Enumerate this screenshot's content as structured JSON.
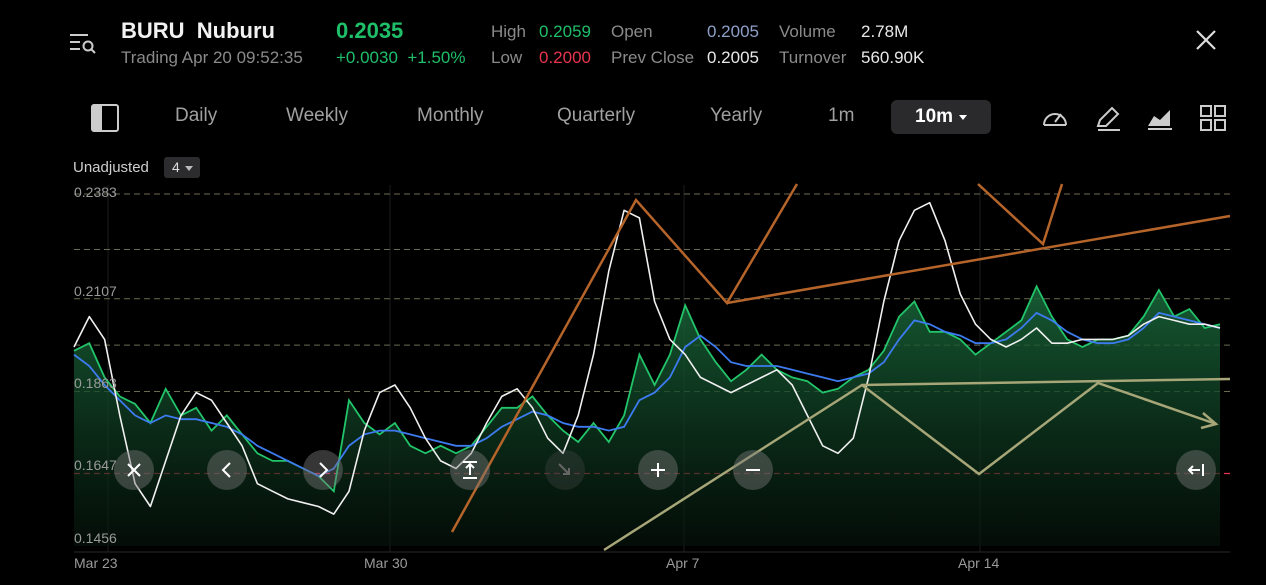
{
  "header": {
    "symbol": "BURU  Nuburu",
    "trading": "Trading Apr 20 09:52:35",
    "price": "0.2035",
    "change": "+0.0030  +1.50%",
    "high_label": "High",
    "high_value": "0.2059",
    "low_label": "Low",
    "low_value": "0.2000",
    "open_label": "Open",
    "open_value": "0.2005",
    "prev_close_label": "Prev Close",
    "prev_close_value": "0.2005",
    "volume_label": "Volume",
    "volume_value": "2.78M",
    "turnover_label": "Turnover",
    "turnover_value": "560.90K"
  },
  "tabs": [
    "Daily",
    "Weekly",
    "Monthly",
    "Quarterly",
    "Yearly",
    "1m"
  ],
  "active_tab": "10m",
  "toolbar_icons": [
    "layout-toggle-icon",
    "speedometer-icon",
    "pen-icon",
    "area-chart-icon",
    "grid-icon"
  ],
  "chart": {
    "adjust_label": "Unadjusted",
    "indicator_count": "4",
    "y_ticks": [
      "0.2383",
      "0.2107",
      "0.1863",
      "0.1647",
      "0.1456"
    ],
    "x_ticks": [
      "Mar 23",
      "Mar 30",
      "Apr 7",
      "Apr 14"
    ]
  },
  "chart_data": {
    "type": "area",
    "x_range": [
      "Mar 23",
      "Apr 20"
    ],
    "ylim": [
      0.1456,
      0.2383
    ],
    "y_ticks": [
      0.2383,
      0.2107,
      0.1863,
      0.1647,
      0.1456
    ],
    "x_ticks": [
      "Mar 23",
      "Mar 30",
      "Apr 7",
      "Apr 14"
    ],
    "reference_line": 0.1647,
    "grid": true,
    "series": [
      {
        "values": [
          0.197,
          0.199,
          0.19,
          0.185,
          0.183,
          0.178,
          0.187,
          0.18,
          0.182,
          0.176,
          0.18,
          0.175,
          0.17,
          0.168,
          0.168,
          0.166,
          0.164,
          0.16,
          0.184,
          0.178,
          0.175,
          0.178,
          0.172,
          0.17,
          0.172,
          0.17,
          0.172,
          0.177,
          0.182,
          0.182,
          0.185,
          0.18,
          0.176,
          0.173,
          0.178,
          0.173,
          0.18,
          0.196,
          0.188,
          0.196,
          0.209,
          0.2,
          0.194,
          0.189,
          0.192,
          0.196,
          0.192,
          0.19,
          0.189,
          0.186,
          0.187,
          0.19,
          0.192,
          0.197,
          0.206,
          0.21,
          0.202,
          0.202,
          0.2,
          0.196,
          0.199,
          0.202,
          0.205,
          0.214,
          0.206,
          0.2,
          0.198,
          0.2,
          0.2,
          0.201,
          0.206,
          0.213,
          0.206,
          0.208,
          0.203,
          0.204
        ]
      },
      {
        "values": [
          0.196,
          0.193,
          0.188,
          0.184,
          0.18,
          0.178,
          0.18,
          0.179,
          0.179,
          0.178,
          0.177,
          0.175,
          0.172,
          0.17,
          0.168,
          0.166,
          0.164,
          0.166,
          0.172,
          0.175,
          0.176,
          0.176,
          0.175,
          0.174,
          0.173,
          0.172,
          0.172,
          0.174,
          0.177,
          0.179,
          0.181,
          0.18,
          0.178,
          0.177,
          0.177,
          0.176,
          0.177,
          0.184,
          0.186,
          0.19,
          0.198,
          0.201,
          0.198,
          0.194,
          0.193,
          0.193,
          0.193,
          0.192,
          0.191,
          0.19,
          0.189,
          0.19,
          0.191,
          0.194,
          0.2,
          0.205,
          0.204,
          0.202,
          0.201,
          0.199,
          0.199,
          0.2,
          0.203,
          0.207,
          0.205,
          0.202,
          0.2,
          0.199,
          0.199,
          0.2,
          0.203,
          0.207,
          0.206,
          0.205,
          0.204,
          0.203
        ]
      },
      {
        "values": [
          0.198,
          0.206,
          0.2,
          0.18,
          0.162,
          0.156,
          0.168,
          0.18,
          0.186,
          0.184,
          0.178,
          0.172,
          0.162,
          0.16,
          0.158,
          0.157,
          0.156,
          0.154,
          0.16,
          0.176,
          0.186,
          0.188,
          0.182,
          0.174,
          0.168,
          0.166,
          0.17,
          0.178,
          0.185,
          0.187,
          0.182,
          0.174,
          0.17,
          0.18,
          0.196,
          0.218,
          0.234,
          0.232,
          0.21,
          0.2,
          0.196,
          0.19,
          0.188,
          0.186,
          0.188,
          0.19,
          0.192,
          0.188,
          0.18,
          0.172,
          0.17,
          0.174,
          0.19,
          0.21,
          0.226,
          0.234,
          0.236,
          0.226,
          0.212,
          0.204,
          0.2,
          0.198,
          0.2,
          0.203,
          0.199,
          0.199,
          0.2,
          0.2,
          0.2,
          0.201,
          0.204,
          0.206,
          0.205,
          0.204,
          0.204,
          0.203
        ]
      }
    ]
  }
}
